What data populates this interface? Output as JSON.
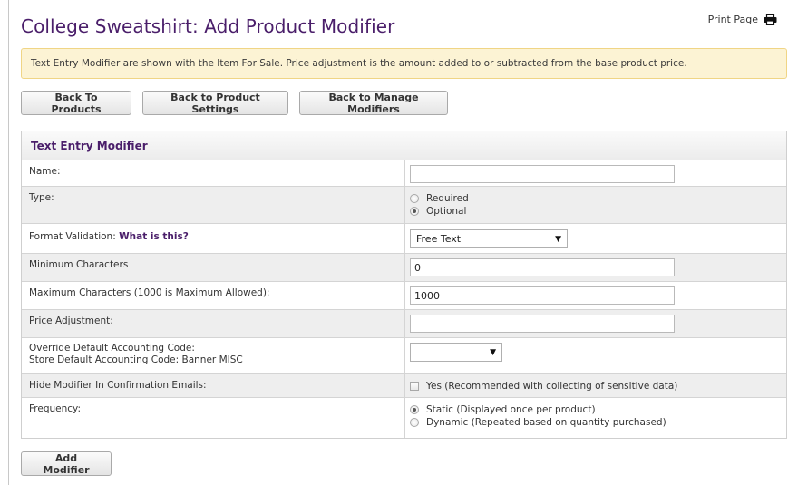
{
  "page": {
    "title": "College Sweatshirt: Add Product Modifier",
    "print_label": "Print Page",
    "print_icon": "printer-icon"
  },
  "alert": {
    "text": "Text Entry Modifier are shown with the Item For Sale. Price adjustment is the amount added to or subtracted from the base product price."
  },
  "nav_buttons": {
    "back_products": "Back To Products",
    "back_settings": "Back to Product Settings",
    "back_modifiers": "Back to Manage Modifiers"
  },
  "form": {
    "heading": "Text Entry Modifier",
    "name": {
      "label": "Name:",
      "value": ""
    },
    "type": {
      "label": "Type:",
      "options": [
        "Required",
        "Optional"
      ],
      "selected": "Optional"
    },
    "format_validation": {
      "label": "Format Validation:",
      "help_link": "What is this?",
      "value": "Free Text"
    },
    "min_chars": {
      "label": "Minimum Characters",
      "value": "0"
    },
    "max_chars": {
      "label": "Maximum Characters (1000 is Maximum Allowed):",
      "value": "1000"
    },
    "price_adjustment": {
      "label": "Price Adjustment:",
      "value": ""
    },
    "accounting": {
      "label_line1": "Override Default Accounting Code:",
      "label_line2": "Store Default Accounting Code: Banner MISC",
      "value": ""
    },
    "hide_modifier": {
      "label": "Hide Modifier In Confirmation Emails:",
      "checkbox_label": "Yes (Recommended with collecting of sensitive data)",
      "checked": false
    },
    "frequency": {
      "label": "Frequency:",
      "options": [
        "Static (Displayed once per product)",
        "Dynamic (Repeated based on quantity purchased)"
      ],
      "selected": "Static (Displayed once per product)"
    }
  },
  "submit": {
    "label": "Add Modifier"
  }
}
